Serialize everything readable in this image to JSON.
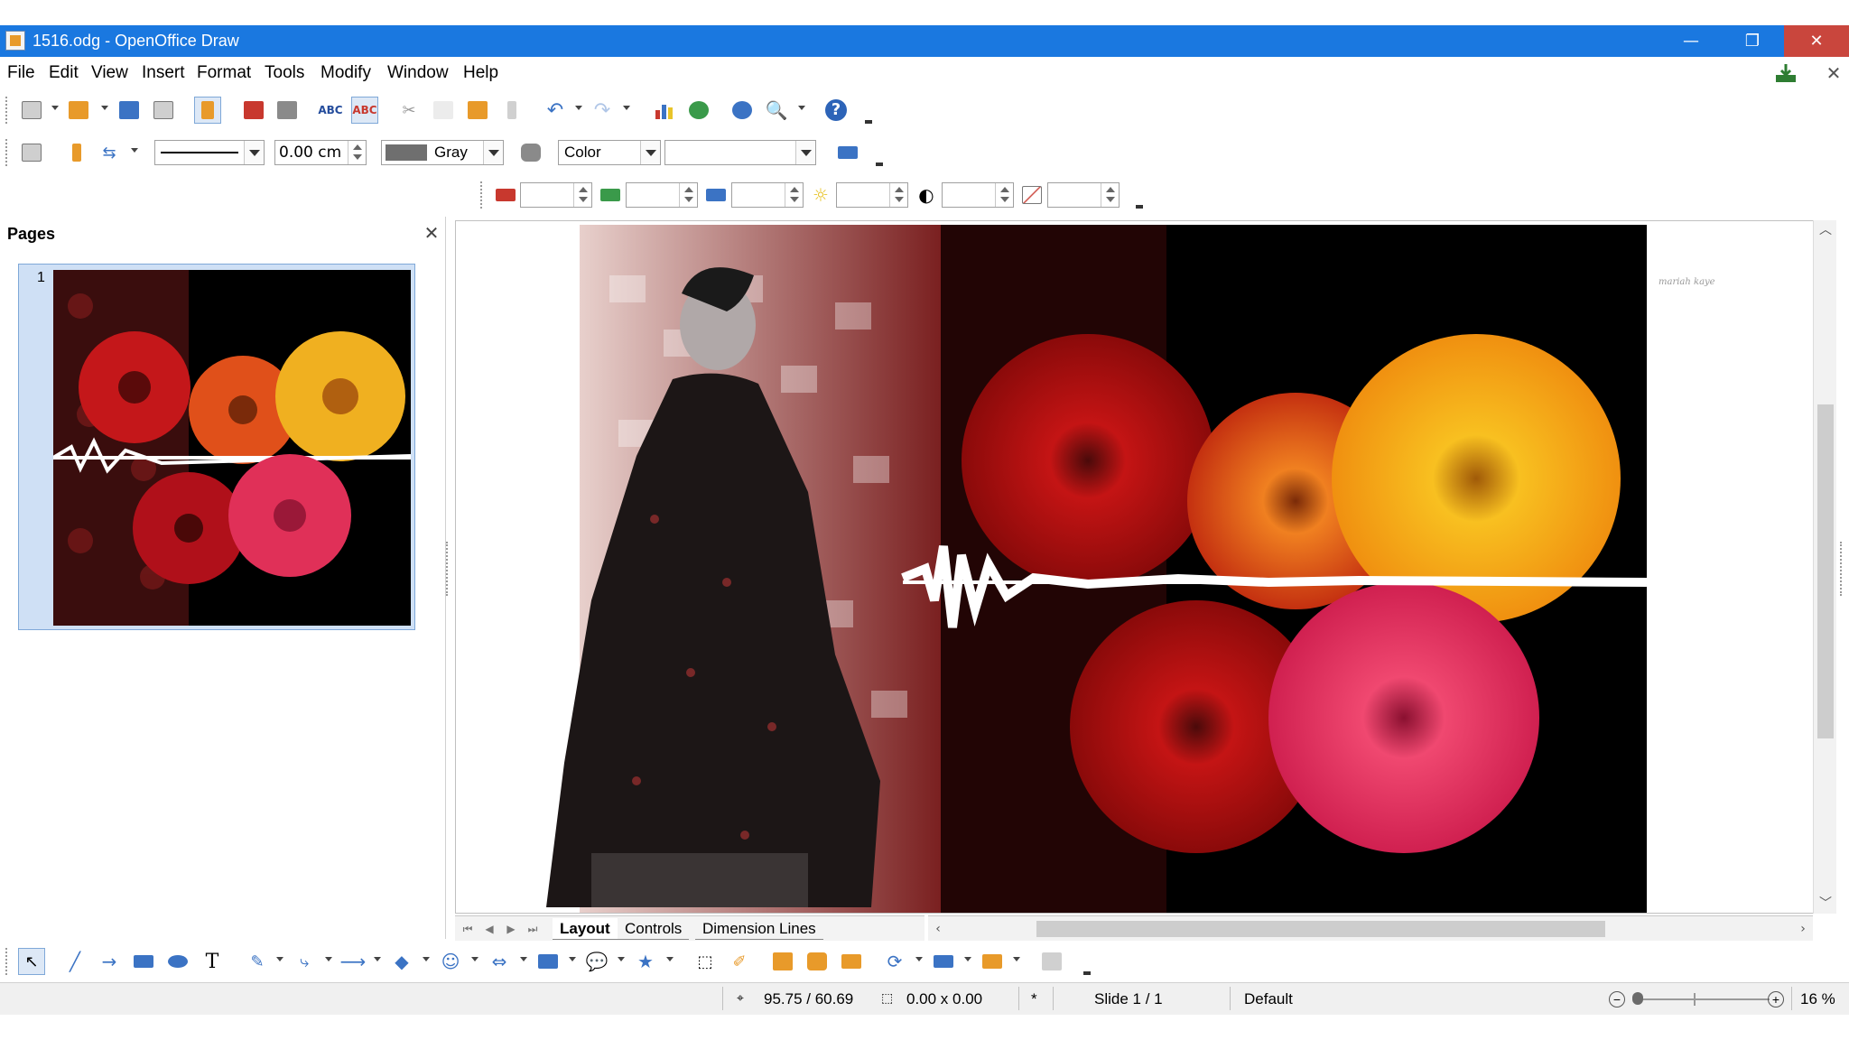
{
  "window": {
    "title": "1516.odg - OpenOffice Draw",
    "min_glyph": "—",
    "max_glyph": "❐",
    "close_glyph": "✕"
  },
  "menu": {
    "items": [
      "File",
      "Edit",
      "View",
      "Insert",
      "Format",
      "Tools",
      "Modify",
      "Window",
      "Help"
    ]
  },
  "line_toolbar": {
    "line_width": "0.00 cm",
    "fill_color_name": "Gray",
    "fill_color_hex": "#6f6f6f",
    "mode": "Color"
  },
  "pages_panel": {
    "title": "Pages",
    "close_glyph": "✕",
    "pages": [
      {
        "number": "1"
      }
    ]
  },
  "sheet_tabs": {
    "tabs": [
      "Layout",
      "Controls",
      "Dimension Lines"
    ],
    "active": "Layout"
  },
  "status": {
    "position": "95.75 / 60.69",
    "size": "0.00 x 0.00",
    "modified": "*",
    "slide": "Slide 1 / 1",
    "layout": "Default",
    "zoom": "16 %"
  },
  "canvas": {
    "signature": "mariah kaye"
  },
  "colors": {
    "titlebar": "#1a78e0",
    "close_button": "#c9463d",
    "selection": "#cfe0f5"
  }
}
